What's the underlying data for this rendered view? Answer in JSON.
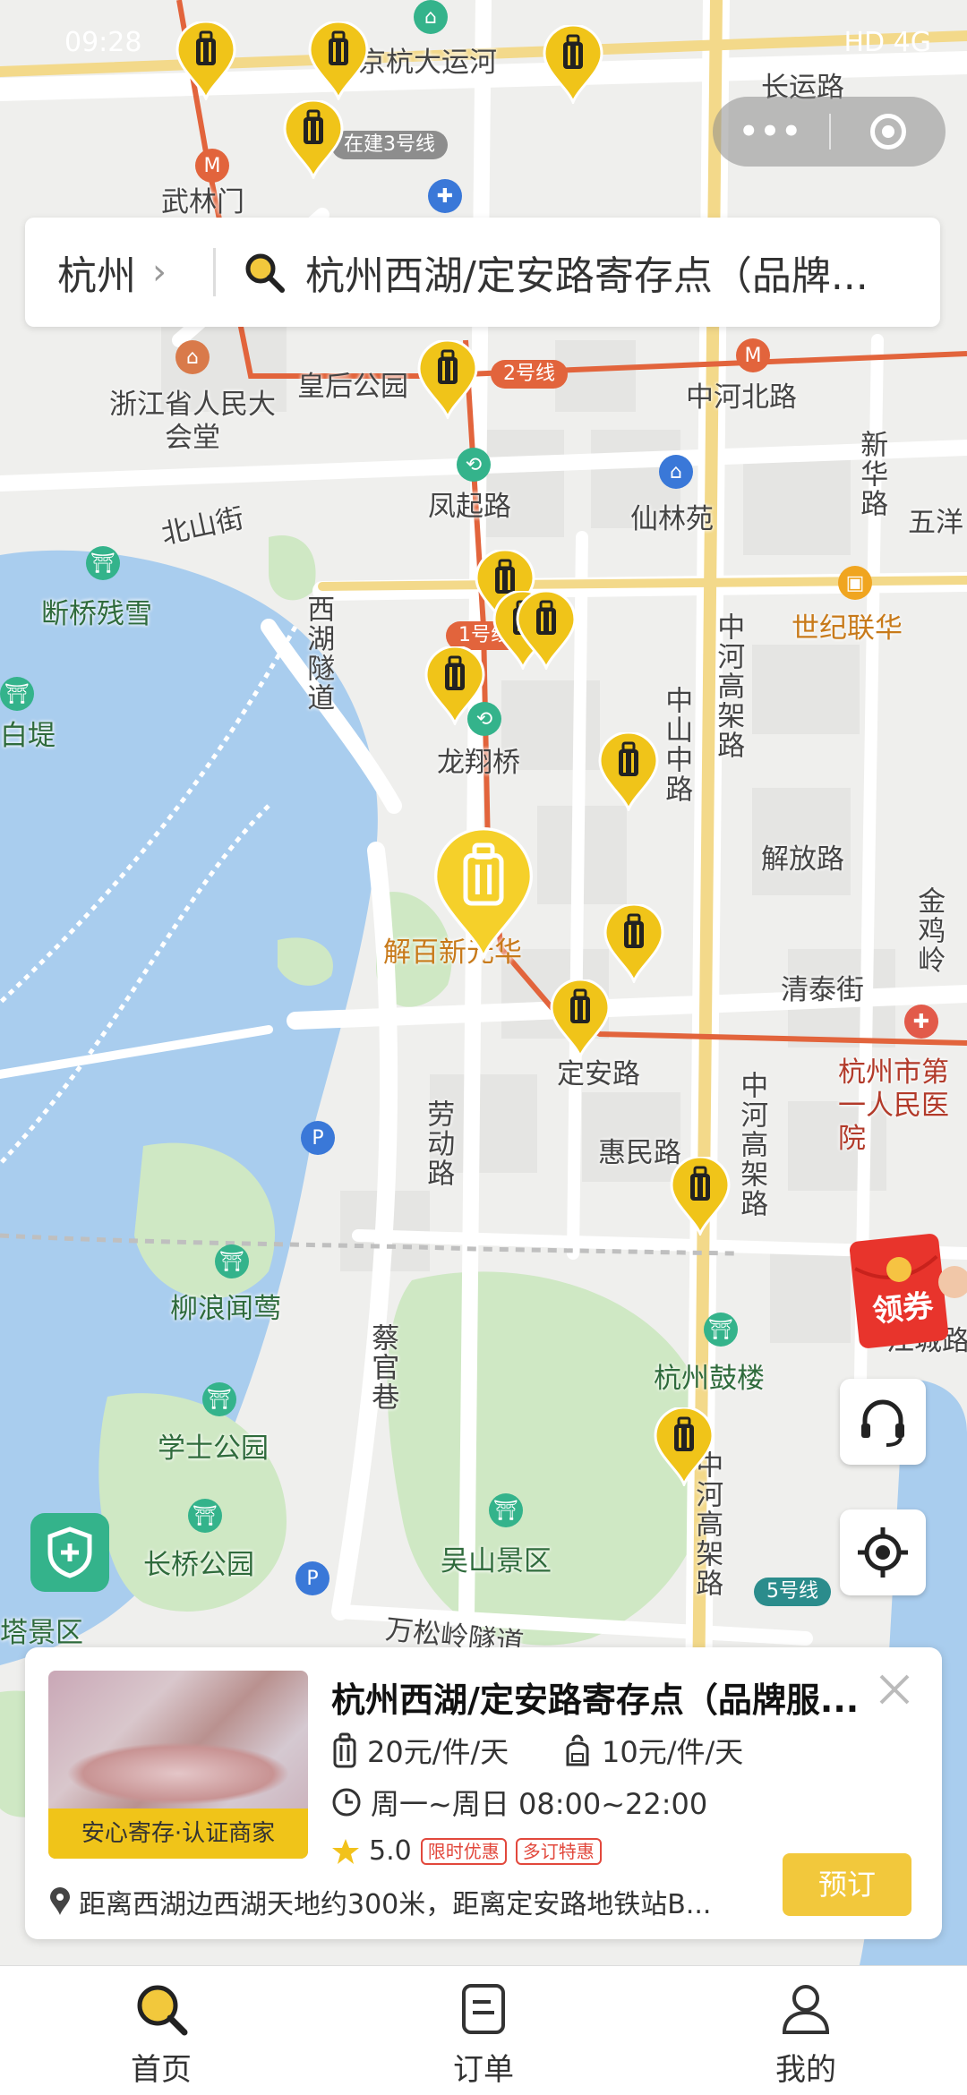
{
  "status": {
    "time": "09:28",
    "right": "HD 4G"
  },
  "capsule": {
    "dots": "•••"
  },
  "search": {
    "city": "杭州",
    "query": "杭州西湖/定安路寄存点（品牌..."
  },
  "map_labels": {
    "yunhe": "京杭大运河",
    "line3_build": "在建3号线",
    "wulinmen": "武林门",
    "changyunlu": "长运路",
    "huanghougongyuan": "皇后公园",
    "zhonghebeilu": "中河北路",
    "line2": "2号线",
    "zjsrdh": "浙江省人民大会堂",
    "beishanjie": "北山街",
    "fengqilu": "凤起路",
    "xianlinyuan": "仙林苑",
    "xinhualu": "新华路",
    "wuyang": "五洋",
    "duanqiaocanxue": "断桥残雪",
    "xihusuidao": "西湖隧道",
    "line1": "1号线",
    "shijilianhua": "世纪联华",
    "zhonghegaojialu": "中河高架路",
    "baidi": "白堤",
    "longxiangqiao": "龙翔桥",
    "zhongshanzhonglu": "中山中路",
    "jiefanglu": "解放路",
    "jinjiling": "金鸡岭",
    "jiebaixinhua": "解百新元华",
    "qingtaijie": "清泰街",
    "dinganlu": "定安路",
    "hzdiyi": "杭州市第一人民医院",
    "laodonglu": "劳动路",
    "huiminlu": "惠民路",
    "zhonghegaojia2": "中河高架路",
    "liulangwenying": "柳浪闻莺",
    "jiangchenglu": "江城路",
    "guanxiang": "蔡官巷",
    "hangzhougulou": "杭州鼓楼",
    "xueshigongyuan": "学士公园",
    "zhonghegaojia3": "中河高架路",
    "changqiaogongyuan": "长桥公园",
    "wushanjingqu": "吴山景区",
    "line5": "5号线",
    "wansonglinglu": "万松岭隧道",
    "tajingqu": "塔景区"
  },
  "coupon": {
    "label": "领券"
  },
  "card": {
    "title": "杭州西湖/定安路寄存点（品牌服...",
    "badge": "安心寄存·认证商家",
    "price_large": "20元/件/天",
    "price_small": "10元/件/天",
    "hours": "周一~周日 08:00~22:00",
    "rating": "5.0",
    "tag1": "限时优惠",
    "tag2": "多订特惠",
    "address": "距离西湖边西湖天地约300米，距离定安路地铁站B...",
    "book": "预订"
  },
  "nav": [
    {
      "label": "首页"
    },
    {
      "label": "订单"
    },
    {
      "label": "我的"
    }
  ],
  "colors": {
    "accent": "#f2c83c",
    "pin": "#f0c419",
    "water": "#a9cdee",
    "park": "#cfe8c4"
  }
}
